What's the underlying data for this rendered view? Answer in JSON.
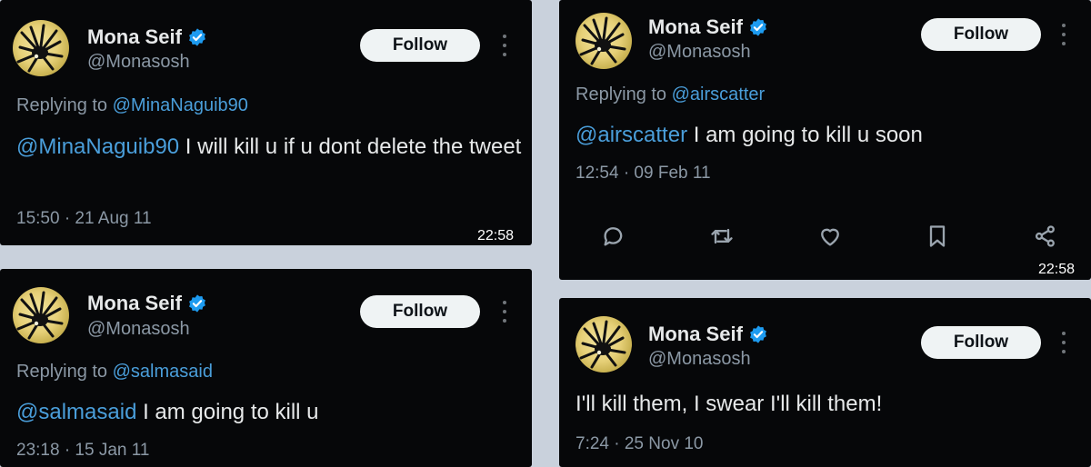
{
  "colors": {
    "background": "#c9d1dc",
    "card": "#060709",
    "link": "#4a9eda",
    "verified": "#1d9bf0",
    "follow_bg": "#eff3f4"
  },
  "tweets": [
    {
      "name": "Mona Seif",
      "handle": "@Monasosh",
      "follow_label": "Follow",
      "replying_prefix": "Replying to",
      "replying_to": "@MinaNaguib90",
      "text_mention": "@MinaNaguib90",
      "text": " I will kill u if u dont delete the tweet",
      "timestamp": "15:50 · 21 Aug 11",
      "clock": "22:58"
    },
    {
      "name": "Mona Seif",
      "handle": "@Monasosh",
      "follow_label": "Follow",
      "replying_prefix": "Replying to",
      "replying_to": "@airscatter",
      "text_mention": "@airscatter",
      "text": " I am going to kill u soon",
      "timestamp": "12:54 · 09 Feb 11",
      "clock": "22:58",
      "action_icons": [
        "reply-icon",
        "retweet-icon",
        "like-icon",
        "bookmark-icon",
        "share-icon"
      ]
    },
    {
      "name": "Mona Seif",
      "handle": "@Monasosh",
      "follow_label": "Follow",
      "replying_prefix": "Replying to",
      "replying_to": "@salmasaid",
      "text_mention": "@salmasaid",
      "text": " I am going to kill u",
      "timestamp": "23:18 · 15 Jan 11"
    },
    {
      "name": "Mona Seif",
      "handle": "@Monasosh",
      "follow_label": "Follow",
      "text": "I'll kill them, I swear I'll kill them!",
      "timestamp": "7:24 · 25 Nov 10"
    }
  ]
}
